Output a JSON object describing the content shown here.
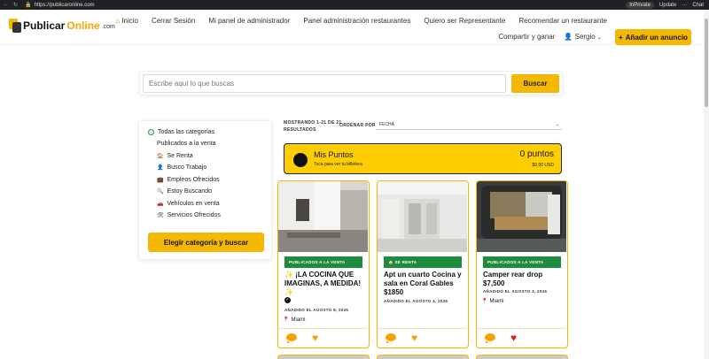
{
  "browser": {
    "url": "https://publicaronline.com",
    "inprivate": "InPrivate",
    "update": "Update",
    "chat": "Chat"
  },
  "header": {
    "logo_part1": "Publicar",
    "logo_part2": "Online",
    "logo_part3": ".com",
    "nav": [
      {
        "icon": "home-icon",
        "label": "Inicio"
      },
      {
        "label": "Cerrar Sesión"
      },
      {
        "label": "Mi panel de administrador"
      },
      {
        "label": "Panel administración restaurantes"
      },
      {
        "label": "Quiero ser Representante"
      },
      {
        "label": "Recomendar un restaurante"
      }
    ],
    "nav2": [
      {
        "label": "Compartir y ganar"
      },
      {
        "label": "Sergio"
      }
    ],
    "add_button": "Añadir un anuncio",
    "add_icon": "+"
  },
  "search": {
    "placeholder": "Escribe aquí lo que buscas",
    "button": "Buscar"
  },
  "categories": {
    "items": [
      {
        "icon": "",
        "label": "Todas las categorías",
        "selected": true
      },
      {
        "icon": "",
        "label": "Publicados a la venta"
      },
      {
        "icon": "🏠",
        "label": "Se Renta"
      },
      {
        "icon": "👤",
        "label": "Busco Trabajo"
      },
      {
        "icon": "💼",
        "label": "Empleos Ofrecidos"
      },
      {
        "icon": "🔍",
        "label": "Estoy Buscando"
      },
      {
        "icon": "🚗",
        "label": "Vehículos en venta"
      },
      {
        "icon": "🛠",
        "label": "Servicios Ofrecidos"
      }
    ],
    "button": "Elegir categoría y buscar"
  },
  "results": {
    "count_line1": "MOSTRANDO 1-21 DE 21",
    "count_line2": "RESULTADOS",
    "order_label": "ORDENAR POR",
    "order_value": "FECHA"
  },
  "points": {
    "title": "Mis Puntos",
    "subtitle": "Toca para ver tu billetera",
    "points": "0 puntos",
    "usd": "$0,00 USD"
  },
  "cards": [
    {
      "badge": "PUBLICADOS A LA VENTA",
      "title_line1": "✨ ¡LA COCINA QUE",
      "title_line2": "IMAGINAS, A MEDIDA!",
      "title_line3": "✨",
      "date": "AÑADIDO EL AGOSTO 8, 2026",
      "location": "Miami",
      "liked": false
    },
    {
      "badge": "🏠 SE RENTA",
      "title_line1": "Apt un cuarto Cocina y",
      "title_line2": "sala en Coral Gables",
      "title_line3": "$1850",
      "date": "AÑADIDO EL AGOSTO 4, 2026",
      "location": "",
      "liked": false
    },
    {
      "badge": "PUBLICADOS A LA VENTA",
      "title_line1": "Camper rear drop",
      "title_line2": "$7,500",
      "title_line3": "",
      "date": "AÑADIDO EL AGOSTO 3, 2026",
      "location": "Miami",
      "liked": true
    }
  ],
  "colors": {
    "accent": "#f5b800",
    "badge_green": "#1d8c3c",
    "heart_red": "#e02020"
  }
}
